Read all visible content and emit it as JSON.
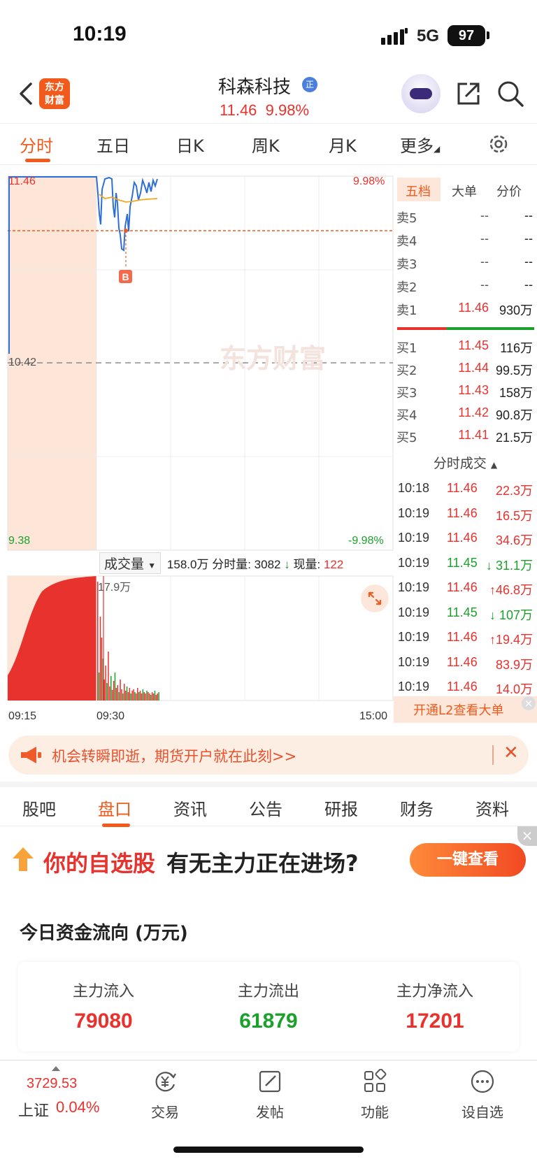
{
  "status_bar": {
    "time": "10:19",
    "network": "5G",
    "battery": "97"
  },
  "header": {
    "logo": "东方财富",
    "stock_name": "科森科技",
    "badge": "正",
    "price": "11.46",
    "change_pct": "9.98%"
  },
  "period_tabs": [
    "分时",
    "五日",
    "日K",
    "周K",
    "月K",
    "更多"
  ],
  "chart": {
    "price_high": "11.46",
    "pct_high": "9.98%",
    "price_mid": "10.42",
    "price_low": "9.38",
    "pct_low": "-9.98%",
    "watermark": "东方财富",
    "buy_marker": "B",
    "vol_peak": "17.9万",
    "time_start": "09:15",
    "time_mid": "09:30",
    "time_end": "15:00",
    "colors": {
      "up": "#e8322d",
      "down": "#1aa12b",
      "price_line": "#2e6fd6",
      "avg_line": "#f0a81e",
      "auction_bg": "#fde6d8"
    }
  },
  "volume_toolbar": {
    "selector": "成交量",
    "total": "158.0万",
    "tick_label": "分时量:",
    "tick_value": "3082",
    "now_label": "现量:",
    "now_value": "122"
  },
  "order_book": {
    "tabs": [
      "五档",
      "大单",
      "分价"
    ],
    "asks": [
      {
        "label": "卖5",
        "price": "--",
        "vol": "--"
      },
      {
        "label": "卖4",
        "price": "--",
        "vol": "--"
      },
      {
        "label": "卖3",
        "price": "--",
        "vol": "--"
      },
      {
        "label": "卖2",
        "price": "--",
        "vol": "--"
      },
      {
        "label": "卖1",
        "price": "11.46",
        "vol": "930万"
      }
    ],
    "bids": [
      {
        "label": "买1",
        "price": "11.45",
        "vol": "116万"
      },
      {
        "label": "买2",
        "price": "11.44",
        "vol": "99.5万"
      },
      {
        "label": "买3",
        "price": "11.43",
        "vol": "158万"
      },
      {
        "label": "买4",
        "price": "11.42",
        "vol": "90.8万"
      },
      {
        "label": "买5",
        "price": "11.41",
        "vol": "21.5万"
      }
    ]
  },
  "ticks": {
    "header": "分时成交",
    "rows": [
      {
        "time": "10:18",
        "price": "11.46",
        "vol": "22.3万",
        "dir": ""
      },
      {
        "time": "10:19",
        "price": "11.46",
        "vol": "16.5万",
        "dir": ""
      },
      {
        "time": "10:19",
        "price": "11.46",
        "vol": "34.6万",
        "dir": ""
      },
      {
        "time": "10:19",
        "price": "11.45",
        "vol": "↓ 31.1万",
        "dir": "down"
      },
      {
        "time": "10:19",
        "price": "11.46",
        "vol": "↑46.8万",
        "dir": "up"
      },
      {
        "time": "10:19",
        "price": "11.45",
        "vol": "↓ 107万",
        "dir": "down"
      },
      {
        "time": "10:19",
        "price": "11.46",
        "vol": "↑19.4万",
        "dir": "up"
      },
      {
        "time": "10:19",
        "price": "11.46",
        "vol": "83.9万",
        "dir": ""
      },
      {
        "time": "10:19",
        "price": "11.46",
        "vol": "14.0万",
        "dir": ""
      }
    ],
    "l2_banner": "开通L2查看大单"
  },
  "promo": {
    "text": "机会转瞬即逝，期货开户就在此刻>>"
  },
  "content_tabs": [
    "股吧",
    "盘口",
    "资讯",
    "公告",
    "研报",
    "财务",
    "资料"
  ],
  "feature": {
    "title": "你的自选股",
    "subtitle": "有无主力正在进场?",
    "button": "一键查看"
  },
  "fund_flow": {
    "title": "今日资金流向 (万元)",
    "inflow_label": "主力流入",
    "inflow": "79080",
    "outflow_label": "主力流出",
    "outflow": "61879",
    "net_label": "主力净流入",
    "net": "17201"
  },
  "bottom_bar": {
    "index_value": "3729.53",
    "index_name": "上证",
    "index_change": "0.04%",
    "items": [
      "交易",
      "发帖",
      "功能",
      "设自选"
    ]
  }
}
